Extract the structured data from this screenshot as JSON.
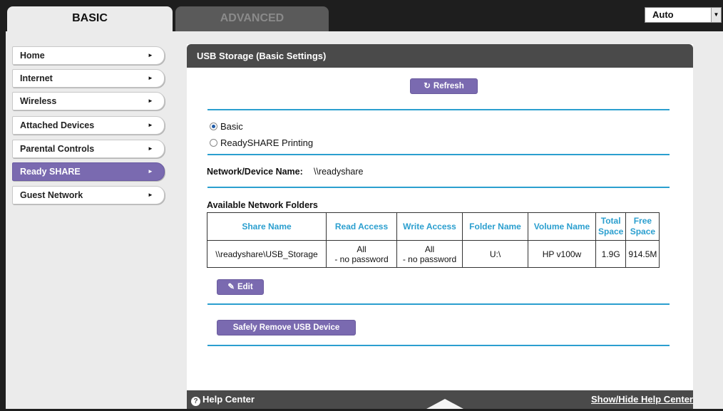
{
  "tabs": {
    "basic": "BASIC",
    "advanced": "ADVANCED"
  },
  "language_select": {
    "value": "Auto"
  },
  "sidebar": {
    "items": [
      {
        "label": "Home"
      },
      {
        "label": "Internet"
      },
      {
        "label": "Wireless"
      },
      {
        "label": "Attached Devices"
      },
      {
        "label": "Parental Controls"
      },
      {
        "label": "Ready SHARE",
        "active": true
      },
      {
        "label": "Guest Network"
      }
    ]
  },
  "panel": {
    "title": "USB Storage (Basic Settings)",
    "refresh_label": "Refresh",
    "mode_options": [
      {
        "label": "Basic",
        "checked": true
      },
      {
        "label": "ReadySHARE Printing",
        "checked": false
      }
    ],
    "network_device_label": "Network/Device Name:",
    "network_device_value": "\\\\readyshare",
    "folders_title": "Available Network Folders",
    "table": {
      "headers": [
        "Share Name",
        "Read Access",
        "Write Access",
        "Folder Name",
        "Volume Name",
        "Total Space",
        "Free Space"
      ],
      "rows": [
        {
          "share_name": "\\\\readyshare\\USB_Storage",
          "read_access_1": "All",
          "read_access_2": "- no password",
          "write_access_1": "All",
          "write_access_2": "- no password",
          "folder_name": "U:\\",
          "volume_name": "HP v100w",
          "total_space": "1.9G",
          "free_space": "914.5M"
        }
      ]
    },
    "edit_label": "Edit",
    "safely_remove_label": "Safely Remove USB Device"
  },
  "footer": {
    "help_center": "Help Center",
    "show_hide": "Show/Hide Help Center"
  },
  "colors": {
    "accent_purple": "#7a6ab0",
    "separator_blue": "#2b9fcf",
    "header_dark": "#4a4a4a"
  },
  "icons": [
    "chevron-right-icon",
    "refresh-icon",
    "pencil-icon",
    "help-icon",
    "triangle-up-icon",
    "dropdown-arrow-icon"
  ]
}
